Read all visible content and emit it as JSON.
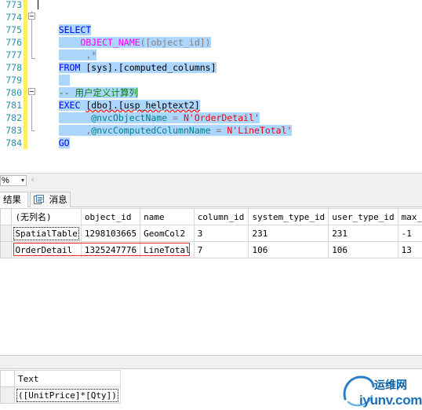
{
  "editor": {
    "line_numbers": [
      "773",
      "774",
      "775",
      "776",
      "777",
      "778",
      "779",
      "780",
      "781",
      "782",
      "783",
      "784"
    ],
    "code": {
      "l774_kw": "SELECT",
      "l775_fn": "OBJECT_NAME",
      "l775_rest": "([object_id])",
      "l776": ",*",
      "l777_kw": "FROM",
      "l777_obj": "[sys].[computed_columns]",
      "l779": "-- 用户定义计算列",
      "l780_kw": "EXEC",
      "l780_obj": "[dbo].[usp_helptext2]",
      "l781_var": "@nvcObjectName",
      "l781_eq": " = ",
      "l781_str": "N'OrderDetail'",
      "l782_comma": ",",
      "l782_var": "@nvcComputedColumnName",
      "l782_eq": " = ",
      "l782_str": "N'LineTotal'",
      "l783_kw": "GO"
    }
  },
  "zoom": {
    "value": "%",
    "arrow": "▾",
    "scroll_left": "‹"
  },
  "tabs": {
    "results": "结果",
    "messages": "消息"
  },
  "results_grid": {
    "columns": [
      "(无列名)",
      "object_id",
      "name",
      "column_id",
      "system_type_id",
      "user_type_id",
      "max_l"
    ],
    "rows": [
      [
        "SpatialTable",
        "1298103665",
        "GeomCol2",
        "3",
        "231",
        "231",
        "-1"
      ],
      [
        "OrderDetail",
        "1325247776",
        "LineTotal",
        "7",
        "106",
        "106",
        "13"
      ]
    ]
  },
  "text_grid": {
    "column": "Text",
    "value": "([UnitPrice]*[Qty])"
  },
  "watermark": {
    "line1": "运维网",
    "line2": "iyunv.com"
  },
  "colors": {
    "selection": "#add6ff",
    "keyword": "#0000ff",
    "function": "#ff00ff",
    "string": "#ff0000",
    "comment": "#008000",
    "annotation": "#e8262b"
  }
}
